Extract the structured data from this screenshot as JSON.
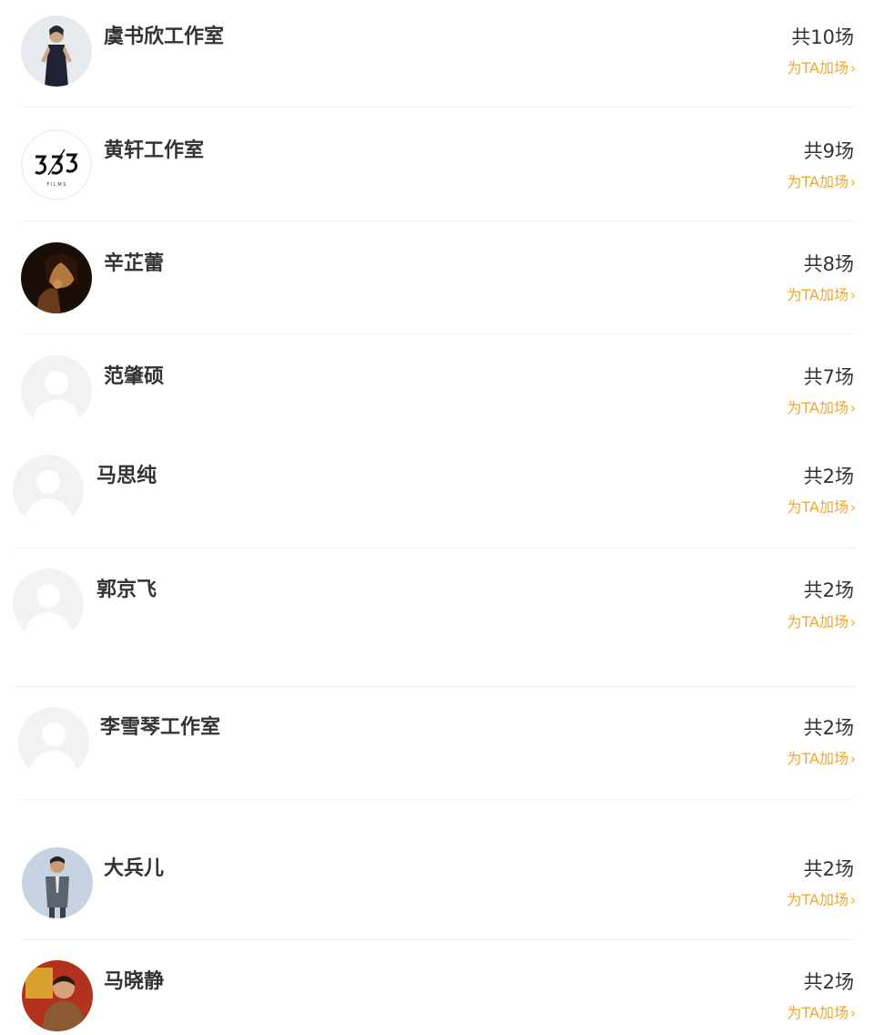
{
  "list": {
    "boost_label": "为TA加场",
    "chevron": "›",
    "items": [
      {
        "name": "虞书欣工作室",
        "count": "共10场",
        "avatar": "photo-woman-dark-dress"
      },
      {
        "name": "黄轩工作室",
        "count": "共9场",
        "avatar": "logo-films"
      },
      {
        "name": "辛芷蕾",
        "count": "共8场",
        "avatar": "photo-woman-dark"
      },
      {
        "name": "范肇硕",
        "count": "共7场",
        "avatar": "placeholder-user"
      },
      {
        "name": "马思纯",
        "count": "共2场",
        "avatar": "placeholder-user"
      },
      {
        "name": "郭京飞",
        "count": "共2场",
        "avatar": "placeholder-user"
      },
      {
        "name": "李雪琴工作室",
        "count": "共2场",
        "avatar": "placeholder-user"
      },
      {
        "name": "大兵儿",
        "count": "共2场",
        "avatar": "photo-man-suit"
      },
      {
        "name": "马晓静",
        "count": "共2场",
        "avatar": "photo-woman-red"
      }
    ]
  },
  "colors": {
    "accent": "#f5a623",
    "text": "#333333",
    "divider": "#f0f0f0",
    "placeholder": "#f2f2f2"
  }
}
